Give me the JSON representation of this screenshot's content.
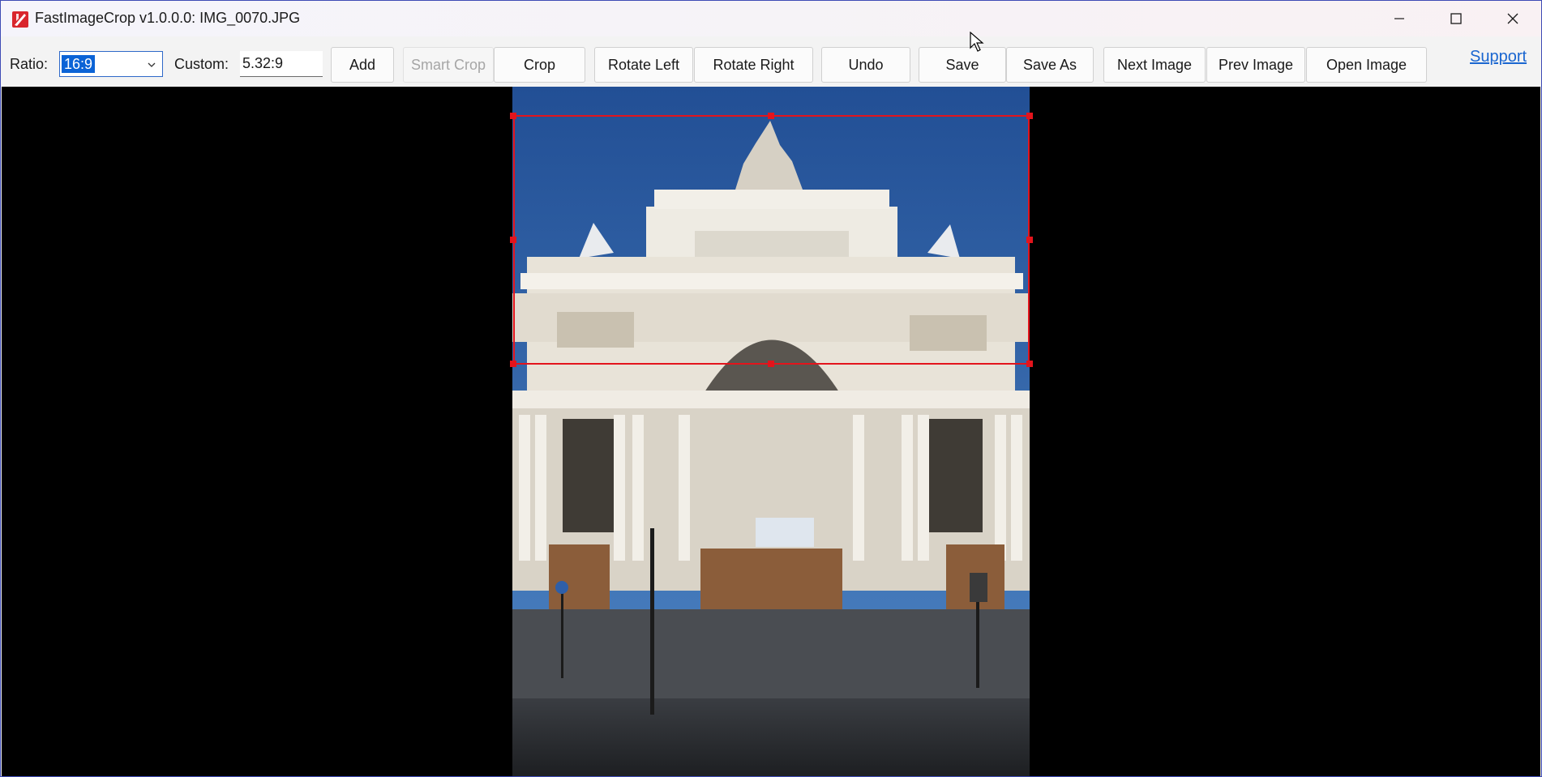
{
  "window": {
    "title": "FastImageCrop v1.0.0.0: IMG_0070.JPG",
    "controls": [
      "minimize-icon",
      "maximize-icon",
      "close-icon"
    ]
  },
  "toolbar": {
    "ratio_label": "Ratio:",
    "ratio_value": "16:9",
    "custom_label": "Custom:",
    "custom_value": "5.32:9",
    "add_label": "Add",
    "smart_crop_label": "Smart Crop",
    "crop_label": "Crop",
    "rotate_left_label": "Rotate Left",
    "rotate_right_label": "Rotate Right",
    "undo_label": "Undo",
    "save_label": "Save",
    "save_as_label": "Save As",
    "next_image_label": "Next Image",
    "prev_image_label": "Prev Image",
    "open_image_label": "Open Image",
    "support_label": "Support"
  },
  "colors": {
    "accent": "#0b63d6",
    "crop_outline": "#e3141c",
    "link": "#1a66d0",
    "canvas_bg": "#000000"
  }
}
